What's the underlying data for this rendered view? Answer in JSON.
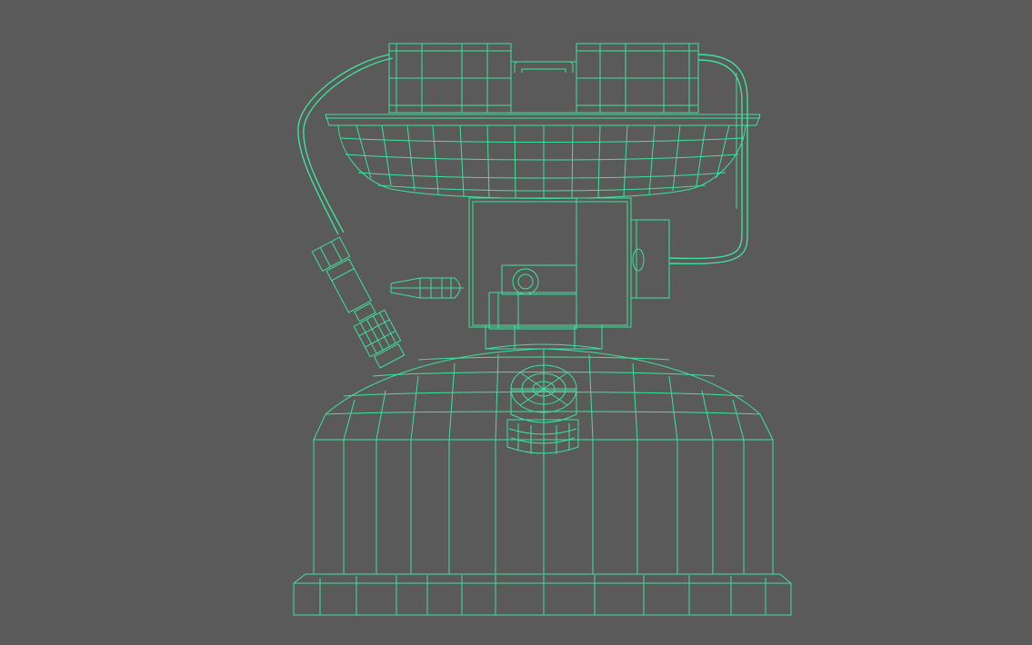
{
  "viewport": {
    "background_color": "#5a5a5a",
    "wireframe_color": "#3fe0a0",
    "shade_light": "#a8a8a8",
    "shade_mid": "#8e8e8e",
    "shade_dark": "#6a6a6a"
  },
  "model": {
    "parts": [
      "burner-cap",
      "burner-bowl",
      "neck-block",
      "valve-block",
      "control-knob",
      "fuel-hose",
      "hose-fitting",
      "pump-knob",
      "tank-dome",
      "tank-body",
      "tank-base"
    ]
  }
}
